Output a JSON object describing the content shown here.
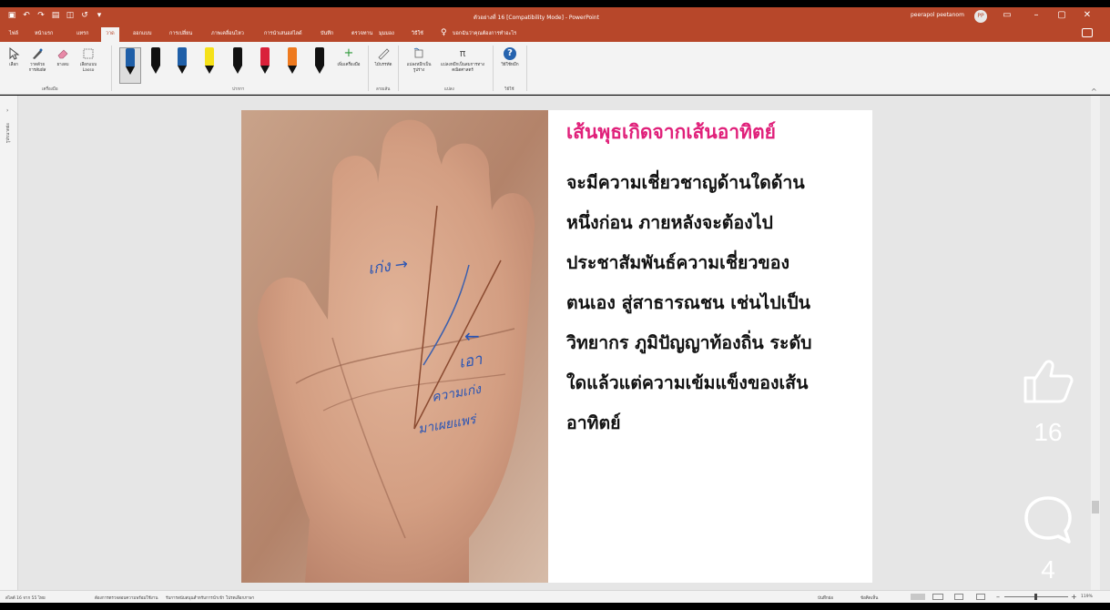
{
  "window": {
    "title": "ตัวอย่างที่ 16 [Compatibility Mode] - PowerPoint",
    "user_name": "peerapol peetanom",
    "user_initials": "PP",
    "controls": {
      "ribbon_display": "▭",
      "minimize": "–",
      "restore": "▢",
      "close": "✕"
    }
  },
  "quick_access": [
    "save",
    "undo",
    "redo",
    "from-beginning",
    "preview",
    "undo-dropdown",
    "customize"
  ],
  "tabs": [
    {
      "label": "ไฟล์",
      "active": false
    },
    {
      "label": "หน้าแรก",
      "active": false
    },
    {
      "label": "แทรก",
      "active": false
    },
    {
      "label": "วาด",
      "active": true
    },
    {
      "label": "ออกแบบ",
      "active": false
    },
    {
      "label": "การเปลี่ยน",
      "active": false
    },
    {
      "label": "ภาพเคลื่อนไหว",
      "active": false
    },
    {
      "label": "การนำเสนอสไลด์",
      "active": false
    },
    {
      "label": "บันทึก",
      "active": false
    },
    {
      "label": "ตรวจทาน",
      "active": false
    },
    {
      "label": "มุมมอง",
      "active": false
    },
    {
      "label": "วิธีใช้",
      "active": false
    }
  ],
  "tell_me": "บอกฉันว่าคุณต้องการทำอะไร",
  "ribbon": {
    "tools": [
      {
        "name": "select",
        "label": "เลือก"
      },
      {
        "name": "draw-touch",
        "label": "วาดด้วยการสัมผัส"
      },
      {
        "name": "eraser",
        "label": "ยางลบ"
      },
      {
        "name": "lasso",
        "label": "เลือกแบบ Lasso"
      }
    ],
    "tools_group": "เครื่องมือ",
    "pens": [
      {
        "color": "#1f5fa8"
      },
      {
        "color": "#111111"
      },
      {
        "color": "#1f5fa8"
      },
      {
        "color": "#f5e11a"
      },
      {
        "color": "#111111"
      },
      {
        "color": "#d9213a"
      },
      {
        "color": "#ee7a1f"
      },
      {
        "color": "#111111"
      }
    ],
    "add_pen": "เพิ่มเครื่องมือ",
    "pens_group": "ปากกา",
    "ruler": "ไม้บรรทัด",
    "stencils_group": "ลายเส้น",
    "ink_to_shape": "แปลงหมึกเป็นรูปร่าง",
    "ink_to_math": "แปลงหมึกเป็นสมการทางคณิตศาสตร์",
    "convert_group": "แปลง",
    "help": "วิธีใช้หมึก",
    "help_group": "วิธีใช้"
  },
  "left_pane": {
    "label": "รูปขนาดย่อ",
    "arrow": "›"
  },
  "slide": {
    "title": "เส้นพุธเกิดจากเส้นอาทิตย์",
    "body_lines": [
      "จะมีความเชี่ยวชาญด้านใดด้าน",
      "หนึ่งก่อน ภายหลังจะต้องไป",
      "ประชาสัมพันธ์ความเชี่ยวของ",
      "ตนเอง สู่สาธารณชน เช่นไปเป็น",
      "วิทยากร ภูมิปัญญาท้องถิ่น ระดับ",
      "ใดแล้วแต่ความเข้มแข็งของเส้น",
      "อาทิตย์"
    ],
    "handwriting": {
      "top_note": "เก่ง →",
      "arrow": "←",
      "line1": "เอา",
      "line2": "ความเก่ง",
      "line3": "มาเผยแพร่"
    }
  },
  "status_bar": {
    "slide_info": "สไลด์ 16 จาก 55 ไทย",
    "accessibility": "ต้องการตรวจสอบความพร้อมใช้งาน",
    "tip": "รับการสนับสนุนสำหรับการนำเข้า โปรดเลือกภาษา",
    "notes": "บันทึกย่อ",
    "comments": "ข้อคิดเห็น",
    "zoom": "119%"
  },
  "overlay": {
    "like_count": "16",
    "comment_count": "4"
  }
}
